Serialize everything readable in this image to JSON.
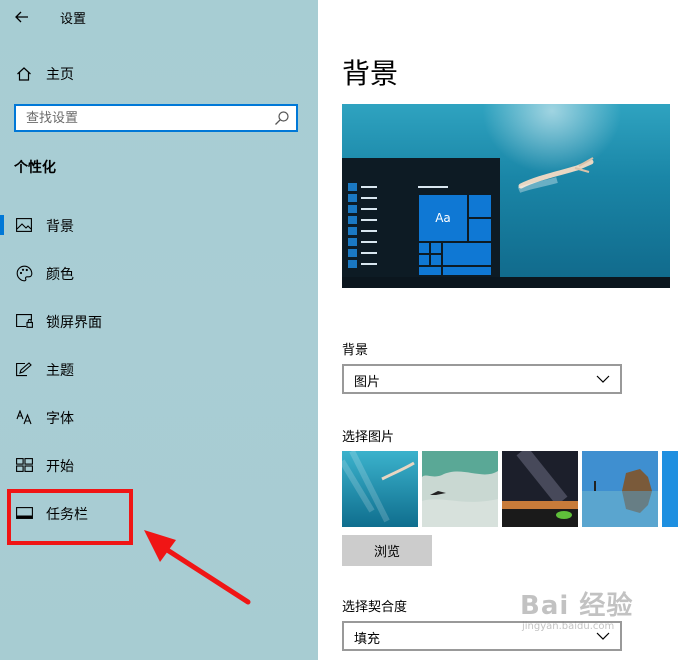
{
  "window": {
    "title": "设置"
  },
  "sidebar": {
    "home_label": "主页",
    "search_placeholder": "查找设置",
    "section_title": "个性化",
    "items": [
      {
        "label": "背景",
        "icon": "image-icon",
        "active": true
      },
      {
        "label": "颜色",
        "icon": "palette-icon",
        "active": false
      },
      {
        "label": "锁屏界面",
        "icon": "lock-screen-icon",
        "active": false
      },
      {
        "label": "主题",
        "icon": "theme-icon",
        "active": false
      },
      {
        "label": "字体",
        "icon": "font-icon",
        "active": false
      },
      {
        "label": "开始",
        "icon": "start-icon",
        "active": false
      },
      {
        "label": "任务栏",
        "icon": "taskbar-icon",
        "active": false
      }
    ]
  },
  "main": {
    "title": "背景",
    "preview": {
      "tile_text": "Aa"
    },
    "background_label": "背景",
    "background_value": "图片",
    "choose_picture_label": "选择图片",
    "browse_label": "浏览",
    "fit_label": "选择契合度",
    "fit_value": "填充"
  },
  "watermark": {
    "main": "Bai 经验",
    "sub": "jingyan.baidu.com"
  },
  "colors": {
    "accent": "#0078d7",
    "sidebar_bg": "#a9cdd4",
    "annotation": "#f01515",
    "button_bg": "#cccccc"
  }
}
